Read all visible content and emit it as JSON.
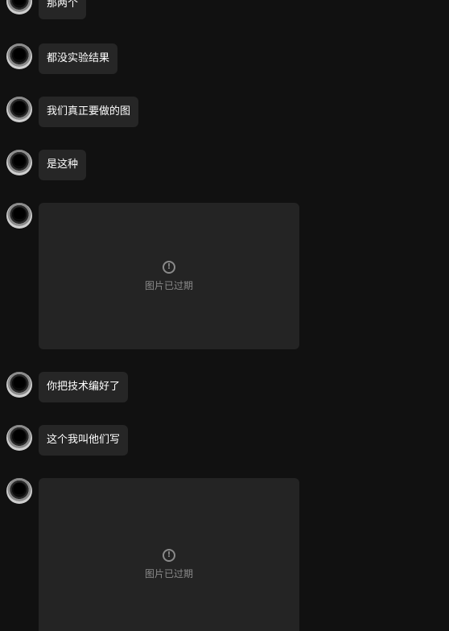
{
  "messages": [
    {
      "type": "text",
      "text": "那两个"
    },
    {
      "type": "text",
      "text": "都没实验结果"
    },
    {
      "type": "text",
      "text": "我们真正要做的图"
    },
    {
      "type": "text",
      "text": "是这种"
    },
    {
      "type": "image",
      "status_text": "图片已过期",
      "icon": "warning-circle-icon",
      "icon_glyph": "!"
    },
    {
      "type": "text",
      "text": "你把技术编好了"
    },
    {
      "type": "text",
      "text": "这个我叫他们写"
    },
    {
      "type": "image",
      "status_text": "图片已过期",
      "icon": "warning-circle-icon",
      "icon_glyph": "!"
    }
  ]
}
